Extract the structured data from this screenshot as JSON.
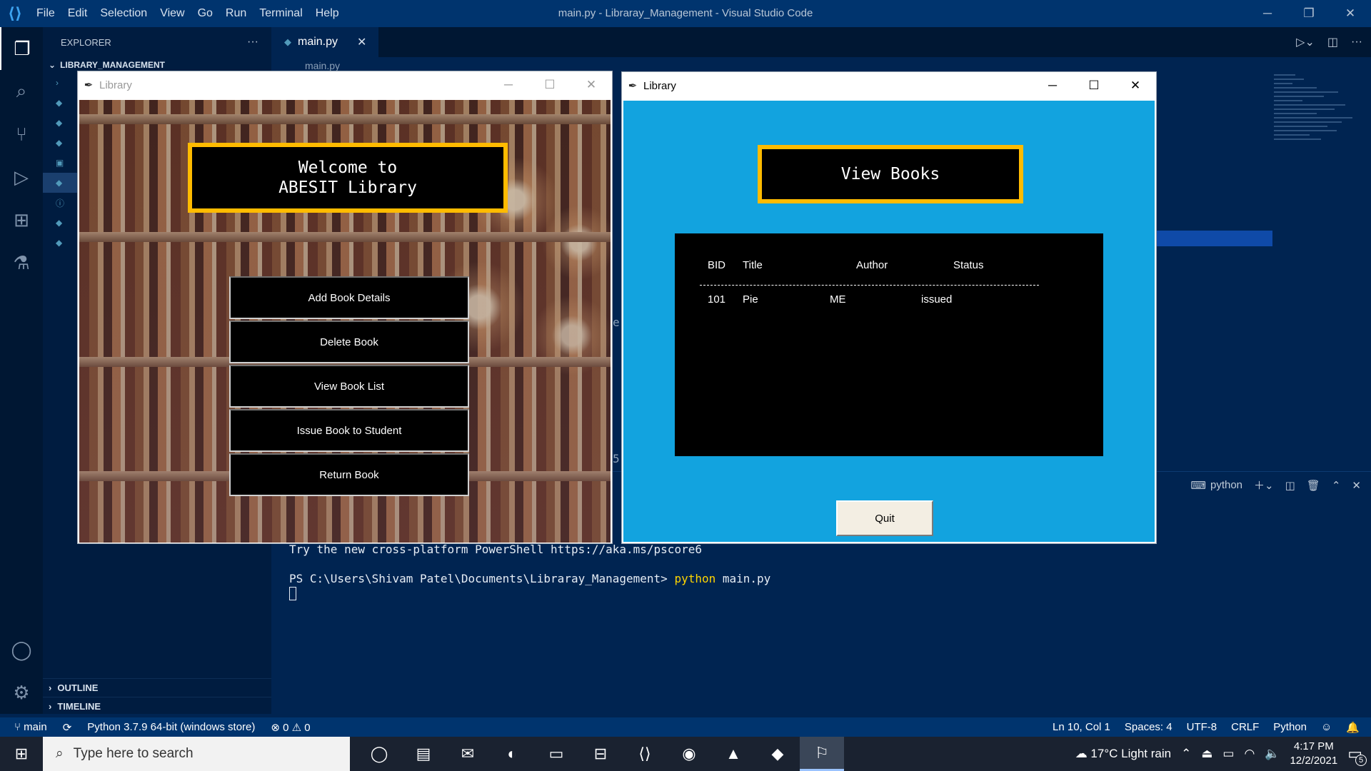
{
  "titlebar": {
    "menu": [
      "File",
      "Edit",
      "Selection",
      "View",
      "Go",
      "Run",
      "Terminal",
      "Help"
    ],
    "window_title": "main.py - Libraray_Management - Visual Studio Code"
  },
  "sidebar": {
    "header": "EXPLORER",
    "project": "LIBRARY_MANAGEMENT",
    "outline": "OUTLINE",
    "timeline": "TIMELINE"
  },
  "editor": {
    "tab_label": "main.py",
    "breadcrumb": "main.py",
    "fragments": [
      "e",
      "5",
      "se"
    ]
  },
  "terminal": {
    "panel_label": "python",
    "line1": "Try the new cross-platform PowerShell https://aka.ms/pscore6",
    "prompt": "PS C:\\Users\\Shivam Patel\\Documents\\Libraray_Management> ",
    "cmd": "python",
    "arg": " main.py"
  },
  "statusbar": {
    "branch": "main",
    "interpreter": "Python 3.7.9 64-bit (windows store)",
    "problems": "0",
    "warnings": "0",
    "position": "Ln 10, Col 1",
    "spaces": "Spaces: 4",
    "encoding": "UTF-8",
    "eol": "CRLF",
    "language": "Python"
  },
  "taskbar": {
    "search_placeholder": "Type here to search",
    "weather": "17°C  Light rain",
    "time": "4:17 PM",
    "date": "12/2/2021",
    "notif_count": "5"
  },
  "library_main": {
    "title": "Library",
    "welcome": "Welcome to\nABESIT Library",
    "buttons": [
      "Add Book Details",
      "Delete Book",
      "View Book List",
      "Issue Book to Student",
      "Return Book"
    ]
  },
  "library_view": {
    "title": "Library",
    "heading": "View Books",
    "columns": [
      "BID",
      "Title",
      "Author",
      "Status"
    ],
    "rows": [
      [
        "101",
        "Pie",
        "ME",
        "issued"
      ]
    ],
    "quit_label": "Quit"
  }
}
